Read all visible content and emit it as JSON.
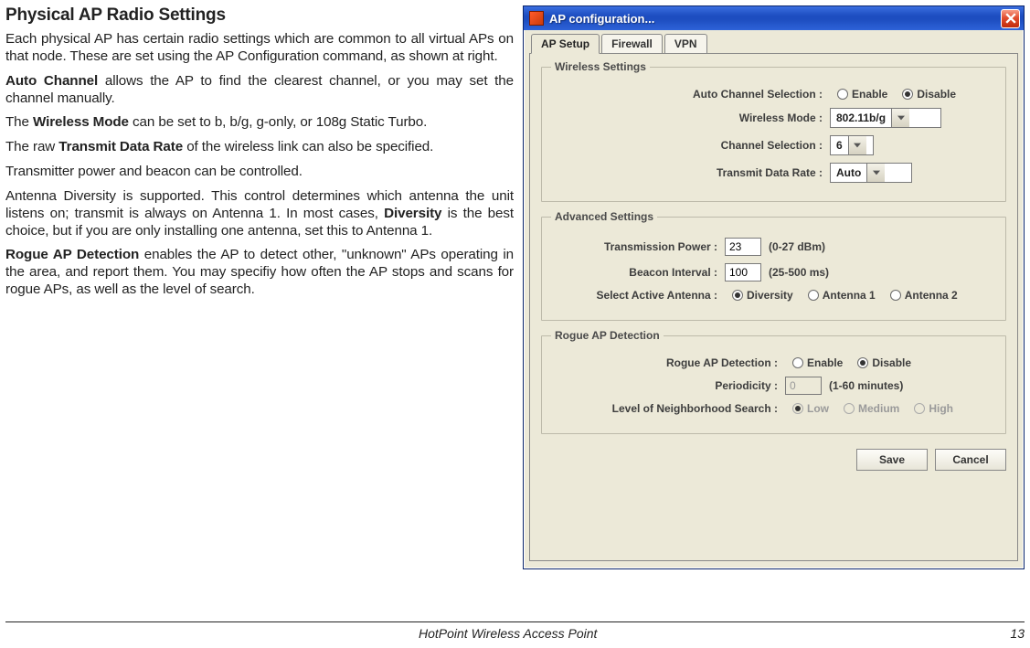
{
  "doc": {
    "heading": "Physical AP Radio Settings",
    "p1": "Each physical AP has certain radio settings which are common to all virtual APs on that node. These are set using the AP Configuration command, as shown at right.",
    "p2a": "Auto Channel",
    "p2b": " allows the AP to find the clearest channel, or you may set the channel manually.",
    "p3a": "The ",
    "p3b": "Wireless Mode",
    "p3c": " can be set to b, b/g, g-only, or 108g Static Turbo.",
    "p4a": "The raw ",
    "p4b": "Transmit Data Rate",
    "p4c": " of the wireless link can also be specified.",
    "p5": "Transmitter power and beacon can be controlled.",
    "p6a": "Antenna Diversity is supported. This control determines which antenna the unit listens on; transmit is always on Antenna 1. In most cases, ",
    "p6b": "Diversity",
    "p6c": " is the best choice, but if you are only installing one antenna, set this to Antenna 1.",
    "p7a": "Rogue AP Detection",
    "p7b": " enables the AP to detect other, \"unknown\" APs operating in the area, and report them. You may specifiy how often the AP stops and scans for rogue APs, as well as the level of search.",
    "footer_center": "HotPoint Wireless Access Point",
    "footer_page": "13"
  },
  "win": {
    "title": "AP configuration...",
    "tabs": {
      "setup": "AP Setup",
      "firewall": "Firewall",
      "vpn": "VPN"
    },
    "wireless": {
      "legend": "Wireless Settings",
      "auto_channel_label": "Auto Channel Selection :",
      "enable": "Enable",
      "disable": "Disable",
      "mode_label": "Wireless Mode :",
      "mode_value": "802.11b/g",
      "channel_label": "Channel Selection :",
      "channel_value": "6",
      "rate_label": "Transmit Data Rate :",
      "rate_value": "Auto"
    },
    "advanced": {
      "legend": "Advanced Settings",
      "power_label": "Transmission Power :",
      "power_value": "23",
      "power_hint": "(0-27 dBm)",
      "beacon_label": "Beacon Interval :",
      "beacon_value": "100",
      "beacon_hint": "(25-500 ms)",
      "antenna_label": "Select Active Antenna :",
      "diversity": "Diversity",
      "ant1": "Antenna 1",
      "ant2": "Antenna 2"
    },
    "rogue": {
      "legend": "Rogue AP Detection",
      "detect_label": "Rogue AP Detection :",
      "enable": "Enable",
      "disable": "Disable",
      "period_label": "Periodicity :",
      "period_value": "0",
      "period_hint": "(1-60 minutes)",
      "search_label": "Level of Neighborhood Search :",
      "low": "Low",
      "medium": "Medium",
      "high": "High"
    },
    "buttons": {
      "save": "Save",
      "cancel": "Cancel"
    }
  }
}
